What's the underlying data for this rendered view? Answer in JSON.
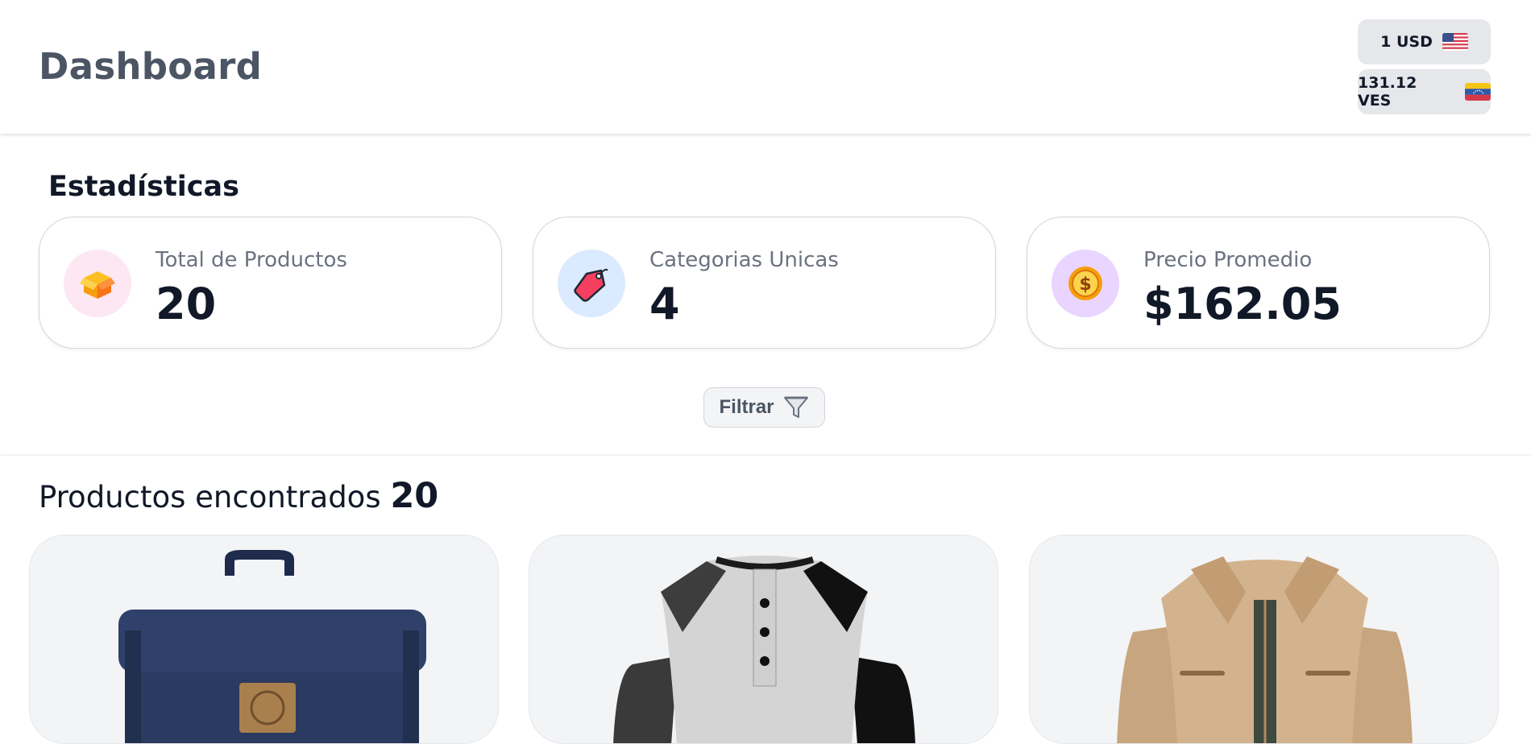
{
  "header": {
    "title": "Dashboard",
    "currencies": [
      {
        "label": "1 USD",
        "flag": "us-flag-icon"
      },
      {
        "label": "131.12 VES",
        "flag": "ve-flag-icon"
      }
    ]
  },
  "stats": {
    "title": "Estadísticas",
    "cards": [
      {
        "label": "Total de Productos",
        "value": "20",
        "icon": "box-icon",
        "icon_bg": "#fce7f3"
      },
      {
        "label": "Categorias Unicas",
        "value": "4",
        "icon": "price-tag-icon",
        "icon_bg": "#dbeafe"
      },
      {
        "label": "Precio Promedio",
        "value": "$162.05",
        "icon": "coin-icon",
        "icon_bg": "#e9d5ff"
      }
    ]
  },
  "filter": {
    "label": "Filtrar",
    "icon": "funnel-icon"
  },
  "results": {
    "label": "Productos encontrados",
    "count": "20",
    "products": [
      {
        "image": "backpack-image"
      },
      {
        "image": "henley-shirt-image"
      },
      {
        "image": "jacket-image"
      }
    ]
  },
  "colors": {
    "title_gray": "#4b5563",
    "label_gray": "#6b7280",
    "chip_bg": "#e5e7eb",
    "card_bg": "#f3f4f6"
  }
}
